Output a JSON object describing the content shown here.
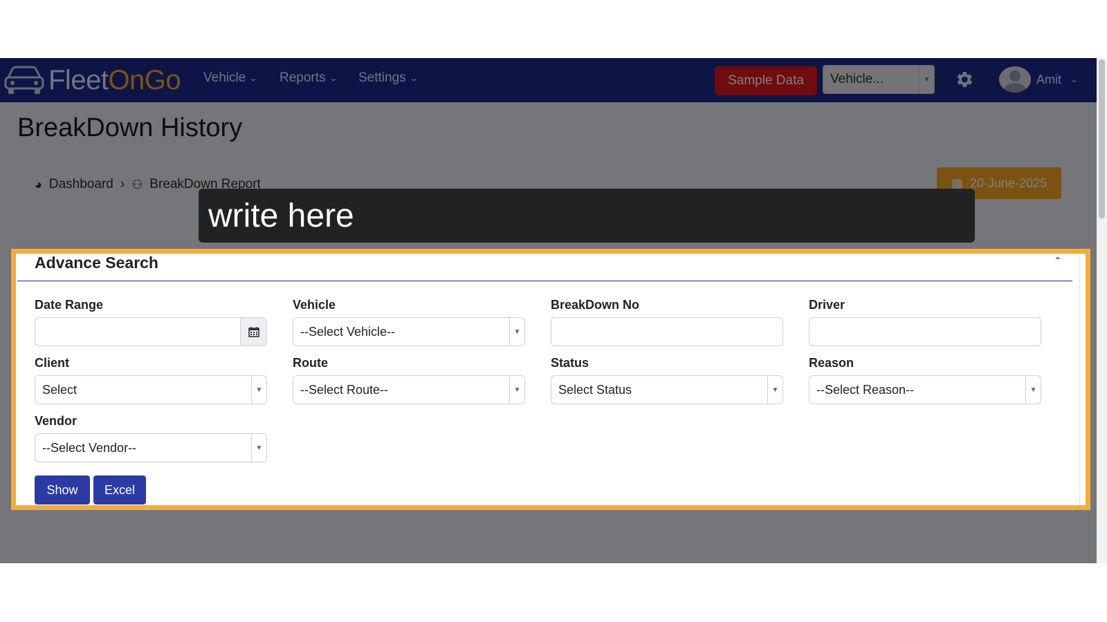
{
  "app": {
    "logo_part1": "Fleet",
    "logo_part2": "OnGo"
  },
  "nav": {
    "items": [
      {
        "label": "Vehicle"
      },
      {
        "label": "Reports"
      },
      {
        "label": "Settings"
      }
    ],
    "sample_data_label": "Sample Data",
    "vehicle_select_value": "Vehicle...",
    "user_name": "Amit"
  },
  "page": {
    "title": "BreakDown History",
    "breadcrumb": [
      "Dashboard",
      "BreakDown Report"
    ],
    "date_badge": "20-June-2025"
  },
  "search": {
    "title": "Advance Search",
    "fields": {
      "date_range": {
        "label": "Date Range",
        "value": ""
      },
      "vehicle": {
        "label": "Vehicle",
        "value": "--Select Vehicle--"
      },
      "breakdown_no": {
        "label": "BreakDown No",
        "value": ""
      },
      "driver": {
        "label": "Driver",
        "value": ""
      },
      "client": {
        "label": "Client",
        "value": "Select"
      },
      "route": {
        "label": "Route",
        "value": "--Select Route--"
      },
      "status": {
        "label": "Status",
        "value": "Select Status"
      },
      "reason": {
        "label": "Reason",
        "value": "--Select Reason--"
      },
      "vendor": {
        "label": "Vendor",
        "value": "--Select Vendor--"
      }
    },
    "show_label": "Show",
    "excel_label": "Excel"
  },
  "tooltip": {
    "text": "write here"
  },
  "colors": {
    "navbar": "#1b2a8f",
    "accent": "#f6ad32",
    "sample_btn": "#e1171e",
    "primary_btn": "#2c3aa6"
  },
  "icons": [
    "car-logo-icon",
    "chevron-down-icon",
    "gear-icon",
    "avatar",
    "dashboard-icon",
    "users-icon",
    "calendar-icon",
    "dropdown-arrow-icon",
    "collapse-up-icon"
  ]
}
